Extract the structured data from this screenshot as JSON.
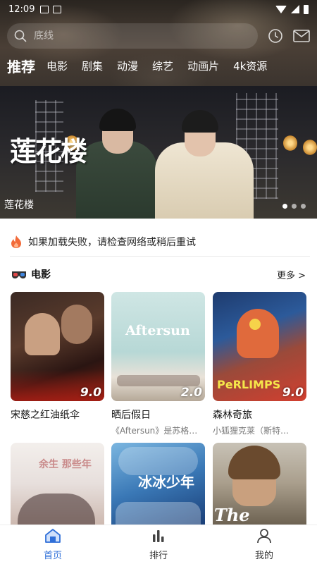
{
  "status_bar": {
    "time": "12:09"
  },
  "search": {
    "placeholder": "底线"
  },
  "category_tabs": [
    {
      "label": "推荐",
      "active": true
    },
    {
      "label": "电影"
    },
    {
      "label": "剧集"
    },
    {
      "label": "动漫"
    },
    {
      "label": "综艺"
    },
    {
      "label": "动画片"
    },
    {
      "label": "4k资源"
    }
  ],
  "banner": {
    "logo_text": "莲花楼",
    "caption": "莲花楼",
    "dots": 3,
    "active_dot": 0
  },
  "notice": {
    "text": "如果加载失败，请检查网络或稍后重试",
    "icon": "flame-icon"
  },
  "section": {
    "title": "电影",
    "more_label": "更多 >",
    "icon": "3d-glasses-icon"
  },
  "movies": [
    {
      "title": "宋慈之红油纸伞",
      "desc": "",
      "score": "9.0",
      "poster_text": ""
    },
    {
      "title": "晒后假日",
      "desc": "《Aftersun》是苏格兰…",
      "score": "2.0",
      "poster_text": "Aftersun"
    },
    {
      "title": "森林奇旅",
      "desc": "小狐狸克莱（斯特…",
      "score": "9.0",
      "poster_text": "PeRLIMPS"
    },
    {
      "title": "",
      "desc": "",
      "score": "",
      "poster_text": "余生 那些年"
    },
    {
      "title": "",
      "desc": "",
      "score": "",
      "poster_text": "冰冰少年"
    },
    {
      "title": "",
      "desc": "",
      "score": "",
      "poster_text": "The Quiet"
    }
  ],
  "bottom_nav": [
    {
      "label": "首页",
      "icon": "home-icon",
      "active": true
    },
    {
      "label": "排行",
      "icon": "ranking-icon"
    },
    {
      "label": "我的",
      "icon": "user-icon"
    }
  ],
  "colors": {
    "accent": "#2f6fd8",
    "flame": "#f26b3a"
  }
}
